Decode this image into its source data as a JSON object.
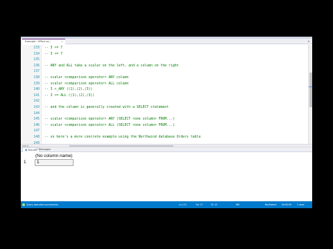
{
  "editor": {
    "tab": {
      "title": "Example - Office Lo...",
      "pin": "×"
    },
    "lines": [
      {
        "num": "133",
        "text": "--  3 <= 7"
      },
      {
        "num": "134",
        "text": "--  3 <= 7"
      },
      {
        "num": "135",
        "text": ""
      },
      {
        "num": "136",
        "text": "-- ANY and ALL take a scalar on the left, and a column on the right"
      },
      {
        "num": "137",
        "text": ""
      },
      {
        "num": "138",
        "text": "-- scalar <comparison operator> ANY column"
      },
      {
        "num": "139",
        "text": "-- scalar <comparison operator> ALL column"
      },
      {
        "num": "140",
        "text": "-- 3 <_ANY ((1),(2),(3))"
      },
      {
        "num": "141",
        "text": "-- 3 >= ALL ((1),(2),(3))"
      },
      {
        "num": "142",
        "text": ""
      },
      {
        "num": "143",
        "text": "-- and the column is generally created with a SELECT statement"
      },
      {
        "num": "144",
        "text": ""
      },
      {
        "num": "145",
        "text": "-- scalar <comparison operator> ANY (SELECT <one column> FROM...)"
      },
      {
        "num": "146",
        "text": "-- scalar <comparison operator> ALL (SELECT <one column> FROM...)"
      },
      {
        "num": "147",
        "text": ""
      },
      {
        "num": "148",
        "text": "-- so here's a more concrete example using the Northwind database Orders table"
      },
      {
        "num": "149",
        "text": ""
      }
    ],
    "zoom": "100 %"
  },
  "results": {
    "tabs": [
      {
        "label": "Results",
        "icon": "grid-icon"
      },
      {
        "label": "Messages",
        "icon": "message-icon"
      }
    ],
    "column_header": "(No column name)",
    "rows": [
      {
        "row_num": "1",
        "value": "1"
      }
    ]
  },
  "status_bar": {
    "message": "Query executed successfully.",
    "items": [
      "Ln 111",
      "Col 17",
      "Ch 12",
      "INS",
      "Northwind",
      "00:00:00",
      "1 rows"
    ]
  },
  "colors": {
    "comment": "#008000",
    "line_number": "#2b91af",
    "status_bar": "#007acc",
    "tab_accent": "#68217a"
  }
}
